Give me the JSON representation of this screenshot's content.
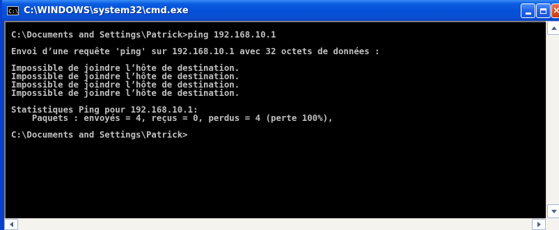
{
  "window": {
    "title": "C:\\WINDOWS\\system32\\cmd.exe",
    "icon": "console-app-icon",
    "icon_text": "C:\\",
    "controls": [
      "minimize",
      "maximize",
      "close"
    ]
  },
  "console": {
    "lines": [
      "",
      "C:\\Documents and Settings\\Patrick>ping 192.168.10.1",
      "",
      "Envoi d’une requête 'ping' sur 192.168.10.1 avec 32 octets de données :",
      "",
      "Impossible de joindre l’hôte de destination.",
      "Impossible de joindre l’hôte de destination.",
      "Impossible de joindre l’hôte de destination.",
      "Impossible de joindre l’hôte de destination.",
      "",
      "Statistiques Ping pour 192.168.10.1:",
      "    Paquets : envoyés = 4, reçus = 0, perdus = 4 (perte 100%),",
      "",
      "C:\\Documents and Settings\\Patrick>"
    ]
  },
  "colors": {
    "titlebar": "#0550d6",
    "console_bg": "#000000",
    "console_fg": "#c0c0c0",
    "close_button": "#d5481f"
  }
}
